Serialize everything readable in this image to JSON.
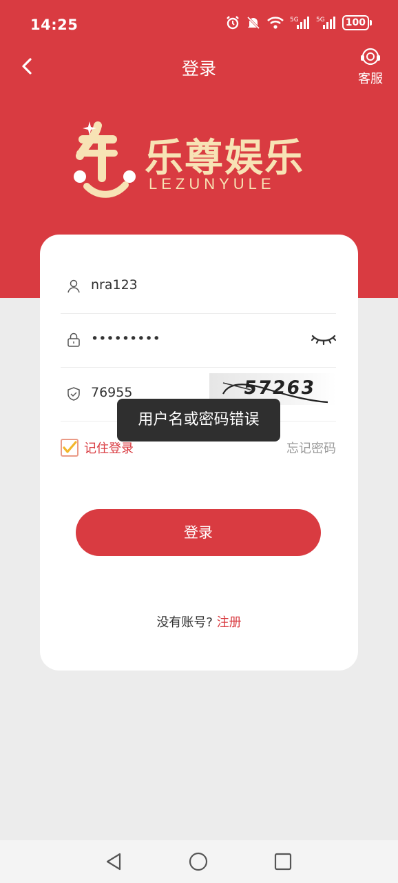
{
  "status_bar": {
    "time": "14:25",
    "battery": "100",
    "network_1": "5G",
    "network_2": "5G",
    "icons": [
      "alarm-icon",
      "mute-icon",
      "wifi-icon",
      "signal-icon",
      "signal-icon",
      "battery-icon"
    ]
  },
  "header": {
    "title": "登录",
    "service_label": "客服"
  },
  "logo": {
    "name_cn": "乐尊娱乐",
    "name_en": "LEZUNYULE"
  },
  "form": {
    "username": "nra123",
    "password_masked": "•••••••••",
    "captcha_input": "76955",
    "captcha_image_text": "57263",
    "remember_label": "记住登录",
    "remember_checked": true,
    "forgot_label": "忘记密码",
    "login_button": "登录",
    "no_account_text": "没有账号?",
    "register_link": "注册"
  },
  "toast": {
    "message": "用户名或密码错误"
  },
  "colors": {
    "primary": "#d93b41",
    "gold": "#f7e3b5",
    "background": "#ececec"
  }
}
